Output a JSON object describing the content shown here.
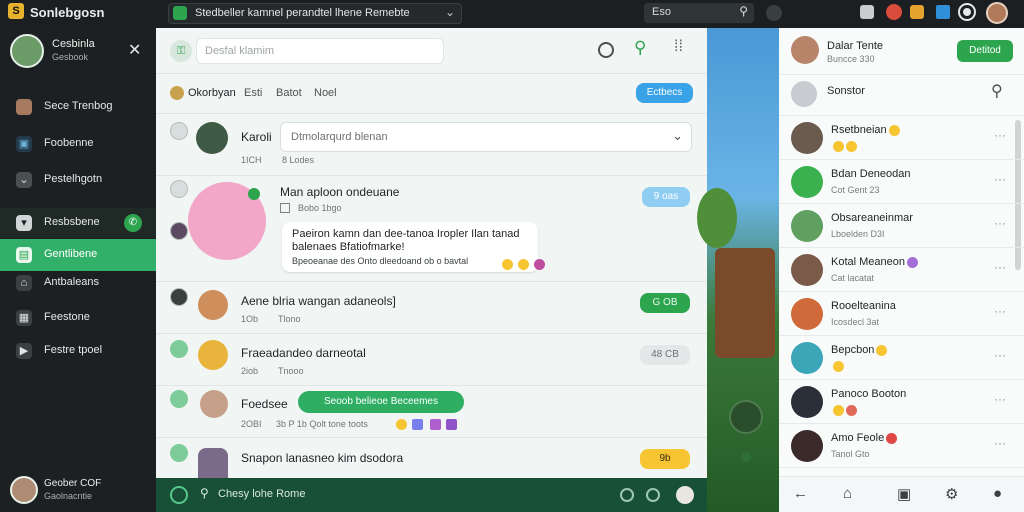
{
  "app": {
    "title": "Sonlebgosn"
  },
  "topbar": {
    "url": "Stedbeller kamnel perandtel lhene Remebte",
    "search": "Eso"
  },
  "leftnav": {
    "profile": {
      "name": "Cesbinla",
      "status": "Gesbook"
    },
    "items": [
      "Sece Trenbog",
      "Foobenne",
      "Pestelhgotn",
      "Resbsbene",
      "Gentlibene",
      "Antbaleans",
      "Feestone",
      "Festre tpoel"
    ],
    "active_index": 4,
    "footer": {
      "name": "Geober COF",
      "sub": "Gaolnacntie"
    }
  },
  "chat": {
    "search_placeholder": "Desfal klamim",
    "tabs": [
      "Okorbyan",
      "Esti",
      "Batot",
      "Noel"
    ],
    "tabs_button": "Ectbecs",
    "composer_placeholder": "Chesy lohe Rome",
    "rows": [
      {
        "name": "Karoli",
        "time": "1ICH",
        "sub": "8 Lodes",
        "dropdown": "Dtmolarqurd blenan"
      },
      {
        "name": "Man aploon ondeuane",
        "time": "Bobo 1bgo",
        "badge": "9 oas",
        "message": "Paeiron kamn dan dee-tanoa Iropler Ilan tanad balenaes Bfatiofmarke!",
        "message_sub": "Bpeoeanae des Onto dleedoand ob o bavtal"
      },
      {
        "name": "Aene blria wangan adaneols]",
        "time": "1Ob",
        "sub": "Tlono",
        "badge": "G OB"
      },
      {
        "name": "Fraeadandeo darneotal",
        "time": "2iob",
        "sub": "Tnooo",
        "badge": "48 CB"
      },
      {
        "name": "Foedsee",
        "time": "2OBI",
        "sub": "3b P 1b Qolt tone toots",
        "chip": "Seoob belieoe Beceemes"
      },
      {
        "name": "Snapon lanasneo kim dsodora",
        "badge": "9b"
      }
    ]
  },
  "right": {
    "header": {
      "name": "Dalar Tente",
      "sub": "Buncce 330",
      "button": "Detitod"
    },
    "search": "Sonstor",
    "contacts": [
      {
        "name": "Rsetbneian",
        "sub": ""
      },
      {
        "name": "Bdan Deneodan",
        "sub": "Cot Gent 23"
      },
      {
        "name": "Obsareaneinmar",
        "sub": "Lboelden D3I"
      },
      {
        "name": "Kotal Meaneon",
        "sub": "Cat lacatat"
      },
      {
        "name": "Rooelteanina",
        "sub": "Icosdecl 3at"
      },
      {
        "name": "Bepcbon",
        "sub": ""
      },
      {
        "name": "Panoco Booton",
        "sub": ""
      },
      {
        "name": "Amo Feole",
        "sub": "Tanol Gto"
      }
    ]
  },
  "colors": {
    "accent": "#2da44e",
    "button_blue": "#3aa3e8",
    "badge_yellow": "#f6c531"
  }
}
